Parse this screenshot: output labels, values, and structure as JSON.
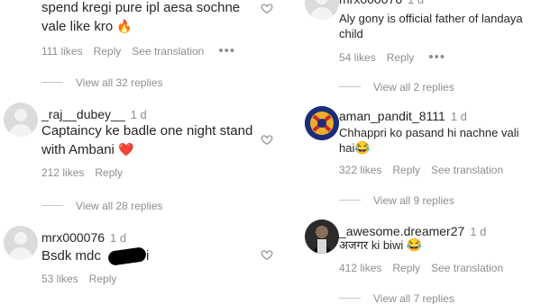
{
  "left": {
    "c1": {
      "text_line1": "spend kregi pure ipl aesa sochne",
      "text_line2": "vale like kro",
      "emoji": "🔥",
      "likes": "111 likes",
      "reply": "Reply",
      "translate": "See translation",
      "more": "•••",
      "view_replies": "View all 32 replies"
    },
    "c2": {
      "username": "_raj__dubey__",
      "age": "1 d",
      "text_line1": "Captaincy ke badle one night stand",
      "text_line2": "with Ambani",
      "emoji": "❤️",
      "likes": "212 likes",
      "reply": "Reply",
      "view_replies": "View all 28 replies"
    },
    "c3": {
      "username": "mrx000076",
      "age": "1 d",
      "text_before": "Bsdk mdc",
      "text_after": "i",
      "likes": "53 likes",
      "reply": "Reply"
    }
  },
  "right": {
    "c1": {
      "username": "mrx000076",
      "age": "1 d",
      "text_line1": "Aly gony is official father of landaya",
      "text_line2": "child",
      "likes": "54 likes",
      "reply": "Reply",
      "more": "•••",
      "view_replies": "View all 2 replies"
    },
    "c2": {
      "username": "aman_pandit_8111",
      "age": "1 d",
      "text_line1": "Chhappri ko pasand hi nachne vali",
      "text_line2": "hai",
      "emoji": "😂",
      "likes": "322 likes",
      "reply": "Reply",
      "translate": "See translation",
      "view_replies": "View all 9 replies"
    },
    "c3": {
      "username": "_awesome.dreamer27",
      "age": "1 d",
      "text": "अजगर ki biwi",
      "emoji": "😂",
      "likes": "412 likes",
      "reply": "Reply",
      "translate": "See translation",
      "view_replies": "View all 7 replies"
    }
  },
  "icons": [
    "heart-outline-icon",
    "more-options-icon",
    "red-heart-emoji",
    "fire-emoji",
    "laughing-emoji"
  ],
  "colors": {
    "text": "#262626",
    "muted": "#8e8e8e",
    "heart_red": "#e0245e"
  }
}
